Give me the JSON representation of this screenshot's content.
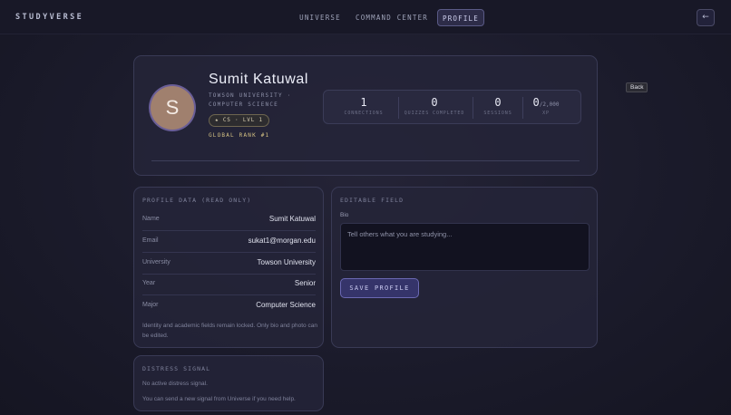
{
  "brand": "STUDYVERSE",
  "nav": {
    "universe": "UNIVERSE",
    "command_center": "COMMAND CENTER",
    "profile": "PROFILE"
  },
  "back": {
    "icon": "arrow-left-icon",
    "glyph": "←",
    "tooltip": "Back"
  },
  "profile": {
    "initial": "S",
    "name": "Sumit Katuwal",
    "university_major": "TOWSON UNIVERSITY · COMPUTER SCIENCE",
    "badge": "★ CS · LVL 1",
    "rank": "GLOBAL RANK #1"
  },
  "stats": {
    "connections": {
      "value": "1",
      "label": "CONNECTIONS"
    },
    "quizzes": {
      "value": "0",
      "label": "QUIZZES COMPLETED"
    },
    "sessions": {
      "value": "0",
      "label": "SESSIONS"
    },
    "xp": {
      "value": "0",
      "max": "/2,000",
      "label": "XP"
    }
  },
  "profile_data": {
    "title": "PROFILE DATA (READ ONLY)",
    "rows": [
      {
        "label": "Name",
        "value": "Sumit Katuwal"
      },
      {
        "label": "Email",
        "value": "sukat1@morgan.edu"
      },
      {
        "label": "University",
        "value": "Towson University"
      },
      {
        "label": "Year",
        "value": "Senior"
      },
      {
        "label": "Major",
        "value": "Computer Science"
      }
    ],
    "note": "Identity and academic fields remain locked. Only bio and photo can be edited."
  },
  "editable": {
    "title": "EDITABLE FIELD",
    "bio_label": "Bio",
    "bio_placeholder": "Tell others what you are studying...",
    "bio_value": "",
    "save_label": "SAVE PROFILE"
  },
  "distress": {
    "title": "DISTRESS SIGNAL",
    "status": "No active distress signal.",
    "hint": "You can send a new signal from Universe if you need help."
  },
  "colors": {
    "accent": "#6a68b2",
    "gold": "#d6c384",
    "avatar": "#a0806e"
  }
}
